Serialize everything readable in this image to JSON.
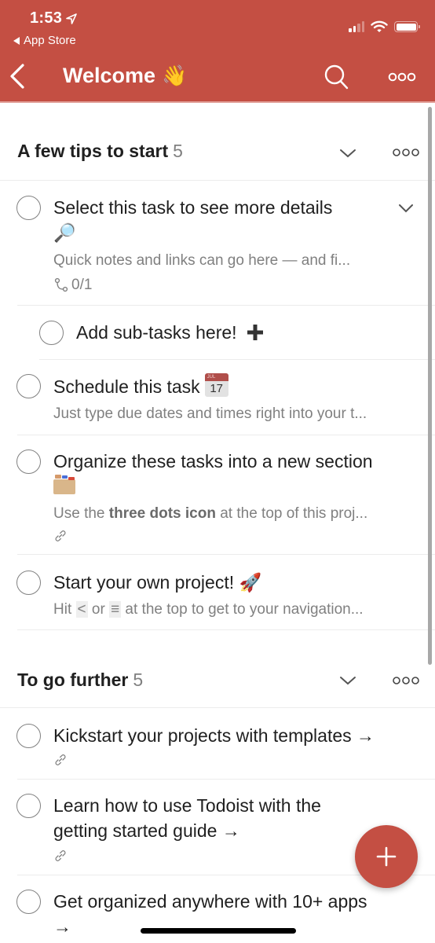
{
  "status_bar": {
    "time": "1:53",
    "back_app_label": "App Store",
    "signal_bars_filled": 2,
    "signal_bars_total": 4,
    "battery_level": 1.0
  },
  "nav": {
    "title": "Welcome",
    "title_emoji": "👋",
    "back_icon": "chevron-left-icon",
    "search_icon": "search-icon",
    "more_icon": "more-horizontal-icon"
  },
  "colors": {
    "brand": "#C44F43",
    "text_primary": "#202020",
    "text_secondary": "#808080",
    "separator": "#ECECEC"
  },
  "sections": [
    {
      "title": "A few tips to start",
      "count": "5",
      "tasks": [
        {
          "title": "Select this task to see more details",
          "title_emoji": "🔎",
          "description": "Quick notes and links can go here — and fi...",
          "subtasks": "0/1",
          "expandable": true
        },
        {
          "title": "Add sub-tasks here!",
          "title_emoji": "➕",
          "is_subtask": true
        },
        {
          "title": "Schedule this task",
          "calendar_month": "JUL",
          "calendar_day": "17",
          "description": "Just type due dates and times right into your t..."
        },
        {
          "title": "Organize these tasks into a new section",
          "title_emoji": "🗂️",
          "description_prefix": "Use the ",
          "description_bold": "three dots icon",
          "description_suffix": " at the top of this proj...",
          "has_link": true
        },
        {
          "title": "Start your own project!",
          "title_emoji": "🚀",
          "description_prefix": "Hit ",
          "description_kbd1": "<",
          "description_mid": " or ",
          "description_kbd2": "≡",
          "description_suffix": " at the top to get to your navigation..."
        }
      ]
    },
    {
      "title": "To go further",
      "count": "5",
      "tasks": [
        {
          "title": "Kickstart your projects with templates →",
          "has_link": true
        },
        {
          "title_line1": "Learn how to use Todoist with the",
          "title_line2": "getting started guide →",
          "has_link": true
        },
        {
          "title_line1": "Get organized anywhere with 10+ apps",
          "title_line2": "→"
        }
      ]
    }
  ],
  "fab": {
    "icon": "plus-icon",
    "label": "Add task"
  }
}
